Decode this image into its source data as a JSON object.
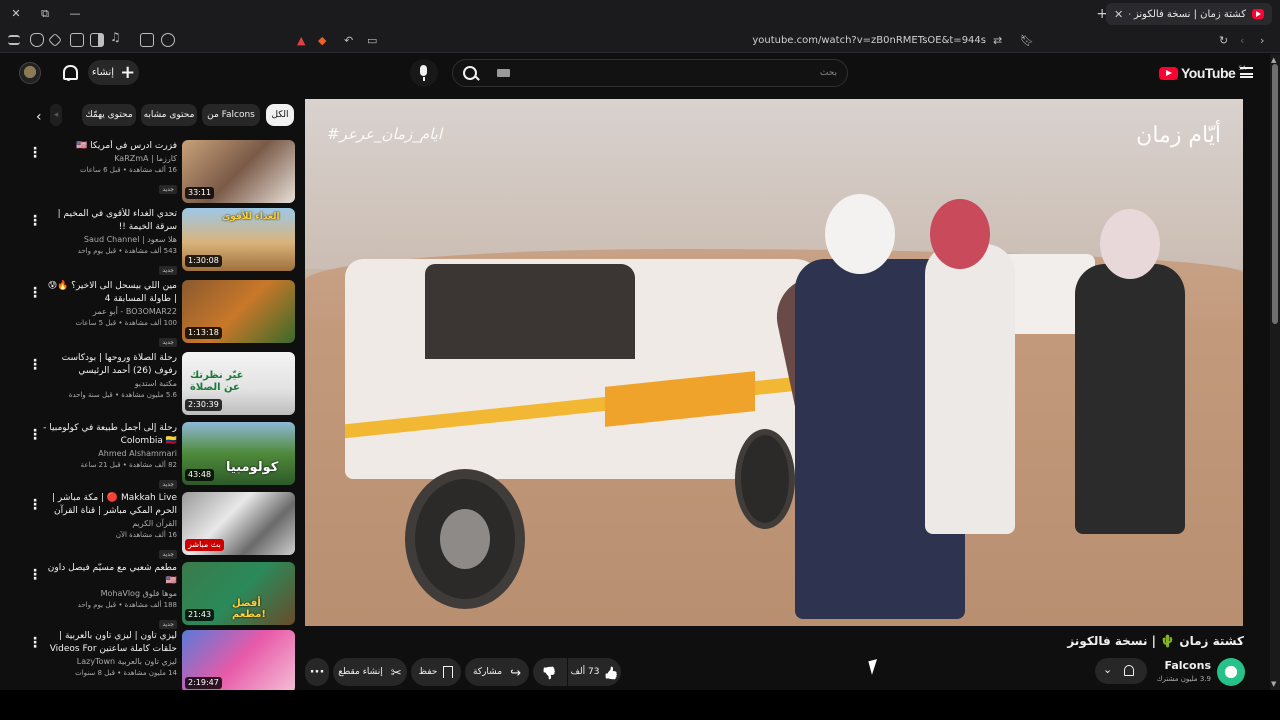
{
  "browser": {
    "tab_title": "كشتة زمان | نسخة فالكونز -",
    "url": "youtube.com/watch?v=zB0nRMETsOE&t=944s",
    "new_tab": "+",
    "close": "✕"
  },
  "header": {
    "create_label": "إنشاء",
    "search_placeholder": "بحث",
    "logo_text": "YouTube",
    "logo_country": "SA"
  },
  "chips": [
    {
      "label": "الكل",
      "active": true
    },
    {
      "label": "من Falcons",
      "active": false
    },
    {
      "label": "محتوى مشابه",
      "active": false
    },
    {
      "label": "محتوى يهمّك",
      "active": false
    }
  ],
  "related": [
    {
      "title": "فزرت ادرس في أمريكا 🇺🇸",
      "channel": "كارزما | KaRZmA",
      "meta": "16 ألف مشاهدة • قبل 6 ساعات",
      "badge": "جديد",
      "duration": "33:11",
      "thumb_text": ""
    },
    {
      "title": "تحدي الغداء للأقوى في المخيم | سرقة الخيمة !!",
      "channel": "هلا سعود | Saud Channel",
      "meta": "543 ألف مشاهدة • قبل يوم واحد",
      "badge": "جديد",
      "duration": "1:30:08",
      "thumb_text": "الغداء للأقوى"
    },
    {
      "title": "مين اللي بيسحل الى الاخير؟ 🔥😰 | طاولة المسابقة 4",
      "channel": "BO3OMAR22 - أبو عمر",
      "meta": "100 ألف مشاهدة • قبل 5 ساعات",
      "badge": "جديد",
      "duration": "1:13:18",
      "thumb_text": ""
    },
    {
      "title": "رحلة الصلاة وروحها | بودكاست رفوف (26) أحمد الرئيسي",
      "channel": "مكتبة استديو",
      "meta": "5.6 مليون مشاهدة • قبل سنة واحدة",
      "badge": "",
      "duration": "2:30:39",
      "thumb_text": "غيّر نظرتك عن الصلاة"
    },
    {
      "title": "رحلة إلى أجمل طبيعة في كولومبيا - Colombia 🇨🇴",
      "channel": "Ahmed Alshammari",
      "meta": "82 ألف مشاهدة • قبل 21 ساعة",
      "badge": "جديد",
      "duration": "43:48",
      "thumb_text": "كولومبيا"
    },
    {
      "title": "Makkah Live 🔴 | مكة مباشر | الحرم المكي مباشر | قناة القرآن الكريم السعودية ...",
      "channel": "القرآن الكريم",
      "meta": "16 ألف مشاهدة الآن",
      "badge": "جديد",
      "duration": "بث مباشر",
      "thumb_text": ""
    },
    {
      "title": "مطعم شعبي مع مسيّم فيصل داون 🇺🇸",
      "channel": "موها فلوق MohaVlog",
      "meta": "188 ألف مشاهدة • قبل يوم واحد",
      "badge": "جديد",
      "duration": "21:43",
      "thumb_text": "أفضل مطعم!"
    },
    {
      "title": "ليزي تاون | ليزي تاون بالعربية | حلقات كاملة ساعتين Videos For Kids",
      "channel": "ليزي تاون بالعربية LazyTown",
      "meta": "14 مليون مشاهدة • قبل 8 سنوات",
      "badge": "",
      "duration": "2:19:47",
      "thumb_text": ""
    }
  ],
  "video": {
    "watermark_left": "#ايام_زمان_عرعر",
    "watermark_right": "أيّام زمان",
    "title": "كشتة زمان 🌵 | نسخة فالكونز"
  },
  "actions": {
    "likes": "73 ألف",
    "share": "مشاركة",
    "save": "حفظ",
    "clip": "إنشاء مقطع"
  },
  "channel": {
    "name": "Falcons",
    "subs": "3.9 مليون مشترك"
  },
  "colors": {
    "background": "#0f0f0f",
    "chip": "#272727",
    "brand_red": "#ff0033",
    "text": "#f1f1f1",
    "muted": "#aaaaaa"
  },
  "icons": [
    "search-icon",
    "mic-icon",
    "bell-icon",
    "plus-icon",
    "hamburger-icon",
    "like-icon",
    "dislike-icon",
    "share-icon",
    "save-icon",
    "clip-icon",
    "more-icon"
  ]
}
